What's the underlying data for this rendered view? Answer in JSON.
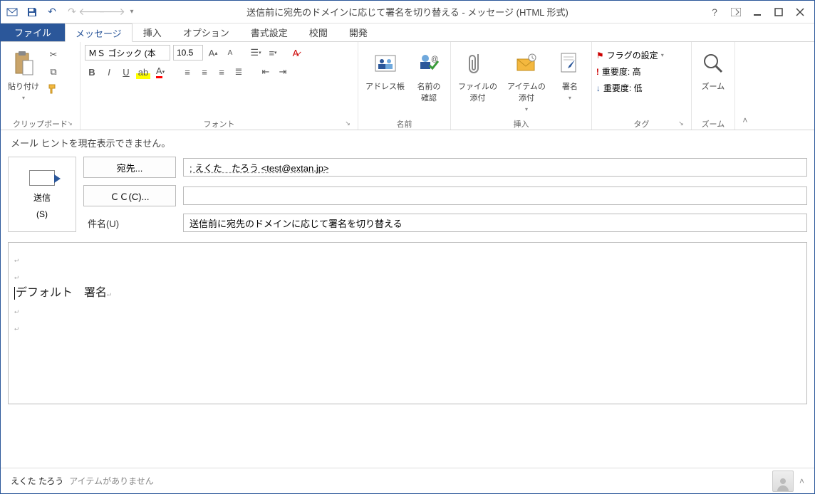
{
  "window": {
    "title": "送信前に宛先のドメインに応じて署名を切り替える - メッセージ (HTML 形式)"
  },
  "qat": {
    "tooltip_save": "上書き保存",
    "tooltip_undo": "元に戻す",
    "tooltip_redo": "やり直し",
    "tooltip_prev": "前へ",
    "tooltip_next": "次へ"
  },
  "tabs": {
    "file": "ファイル",
    "message": "メッセージ",
    "insert": "挿入",
    "options": "オプション",
    "format": "書式設定",
    "review": "校閲",
    "developer": "開発"
  },
  "ribbon": {
    "clipboard": {
      "paste": "貼り付け",
      "label": "クリップボード"
    },
    "font": {
      "family": "ＭＳ ゴシック (本",
      "size": "10.5",
      "label": "フォント"
    },
    "names": {
      "address_book": "アドレス帳",
      "check_names": "名前の\n確認",
      "label": "名前"
    },
    "include": {
      "attach_file": "ファイルの\n添付",
      "attach_item": "アイテムの\n添付",
      "signature": "署名",
      "label": "挿入"
    },
    "tags": {
      "flag": "フラグの設定",
      "high": "重要度: 高",
      "low": "重要度: 低",
      "label": "タグ"
    },
    "zoom": {
      "zoom": "ズーム",
      "label": "ズーム"
    }
  },
  "mailtip": "メール ヒントを現在表示できません。",
  "header": {
    "send1": "送信",
    "send2": "(S)",
    "to_btn": "宛先...",
    "to_value": "; えくた　たろう <test@extan.jp>",
    "cc_btn": "ＣＣ(C)...",
    "cc_value": "",
    "subject_lbl": "件名(U)",
    "subject_value": "送信前に宛先のドメインに応じて署名を切り替える"
  },
  "body": {
    "line1": "デフォルト　署名"
  },
  "status": {
    "user": "えくた たろう",
    "msg": "アイテムがありません"
  }
}
